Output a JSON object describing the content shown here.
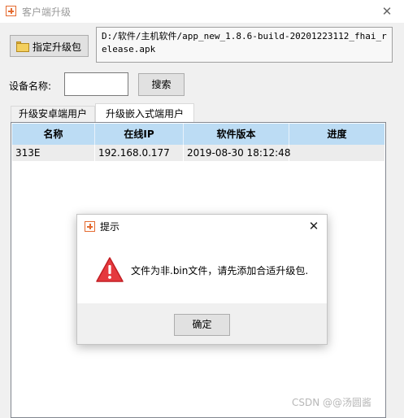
{
  "window": {
    "title": "客户端升级",
    "close_glyph": "✕"
  },
  "toolbar": {
    "select_package_label": "指定升级包",
    "package_path": "D:/软件/主机软件/app_new_1.8.6-build-20201223112_fhai_release.apk"
  },
  "search": {
    "device_label": "设备名称:",
    "device_value": "",
    "search_label": "搜索"
  },
  "tabs": [
    {
      "label": "升级安卓端用户",
      "selected": false
    },
    {
      "label": "升级嵌入式端用户",
      "selected": true
    }
  ],
  "grid": {
    "columns": [
      "名称",
      "在线IP",
      "软件版本",
      "进度"
    ],
    "rows": [
      {
        "name": "313E",
        "ip": "192.168.0.177",
        "version": "2019-08-30 18:12:48",
        "progress": ""
      }
    ]
  },
  "dialog": {
    "title": "提示",
    "message": "文件为非.bin文件，请先添加合适升级包.",
    "ok_label": "确定",
    "close_glyph": "✕",
    "icon": "warning-icon"
  },
  "watermark": "CSDN @@汤圆酱",
  "colors": {
    "header_bg": "#bcdcf4",
    "accent": "#e46a2f",
    "warning": "#e5393e"
  }
}
